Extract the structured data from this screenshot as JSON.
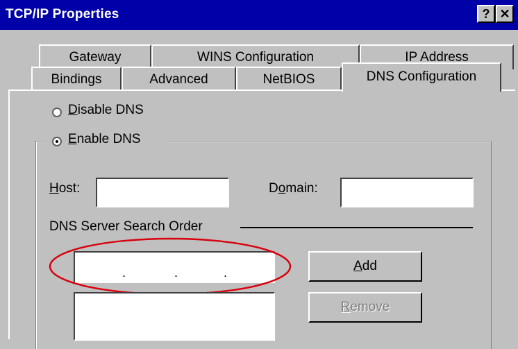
{
  "window": {
    "title": "TCP/IP Properties",
    "help_label": "?",
    "close_label": "✕"
  },
  "tabs_back": [
    {
      "label": "Gateway"
    },
    {
      "label": "WINS Configuration"
    },
    {
      "label": "IP Address"
    }
  ],
  "tabs_front": [
    {
      "label": "Bindings"
    },
    {
      "label": "Advanced"
    },
    {
      "label": "NetBIOS"
    },
    {
      "label": "DNS Configuration",
      "selected": true
    }
  ],
  "dns": {
    "disable": {
      "mnemonic": "D",
      "rest": "isable DNS",
      "checked": false
    },
    "enable": {
      "mnemonic": "E",
      "rest": "nable DNS",
      "checked": true
    },
    "host": {
      "mnemonic": "H",
      "rest": "ost:",
      "value": ""
    },
    "domain": {
      "pre": "D",
      "mnemonic": "o",
      "rest": "main:",
      "value": ""
    },
    "server_order_label": "DNS Server Search Order",
    "ip_dots": [
      ".",
      ".",
      "."
    ],
    "add_button": {
      "mnemonic": "A",
      "rest": "dd"
    },
    "remove_button": {
      "mnemonic": "R",
      "rest": "emove",
      "enabled": false
    }
  },
  "highlight_color": "#d8000c"
}
